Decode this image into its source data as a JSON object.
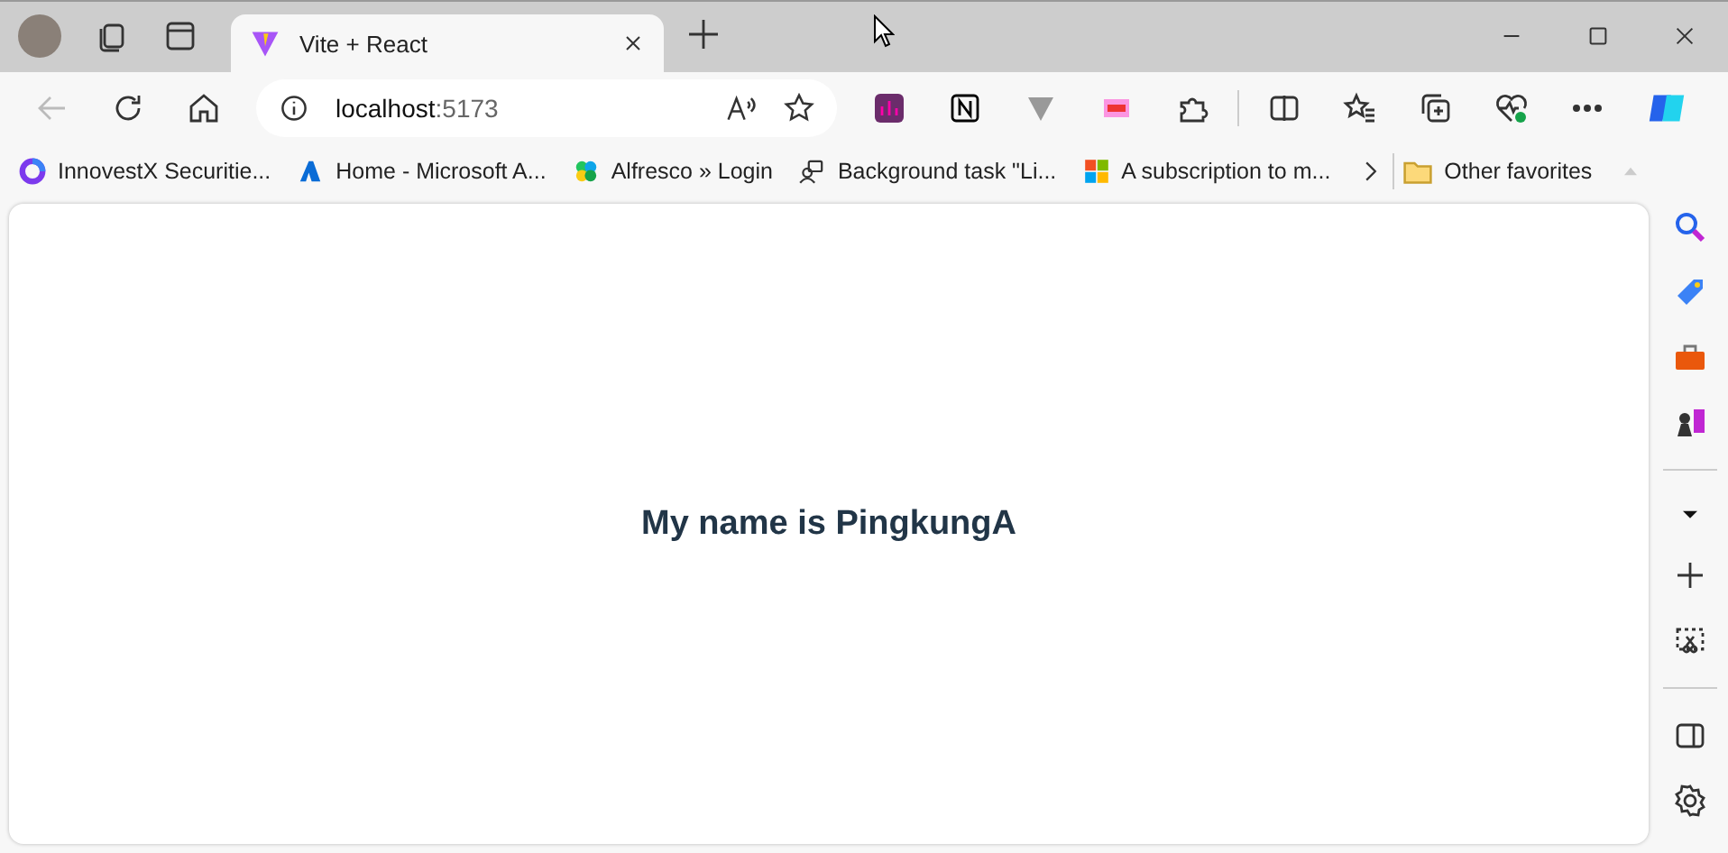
{
  "tab": {
    "title": "Vite + React",
    "selected": true
  },
  "address": {
    "host": "localhost",
    "port": ":5173"
  },
  "bookmarks": [
    {
      "label": "InnovestX Securitie..."
    },
    {
      "label": "Home - Microsoft A..."
    },
    {
      "label": "Alfresco » Login"
    },
    {
      "label": "Background task \"Li..."
    },
    {
      "label": "A subscription to m..."
    }
  ],
  "other_favorites": "Other favorites",
  "page": {
    "heading": "My name is PingkungA"
  }
}
